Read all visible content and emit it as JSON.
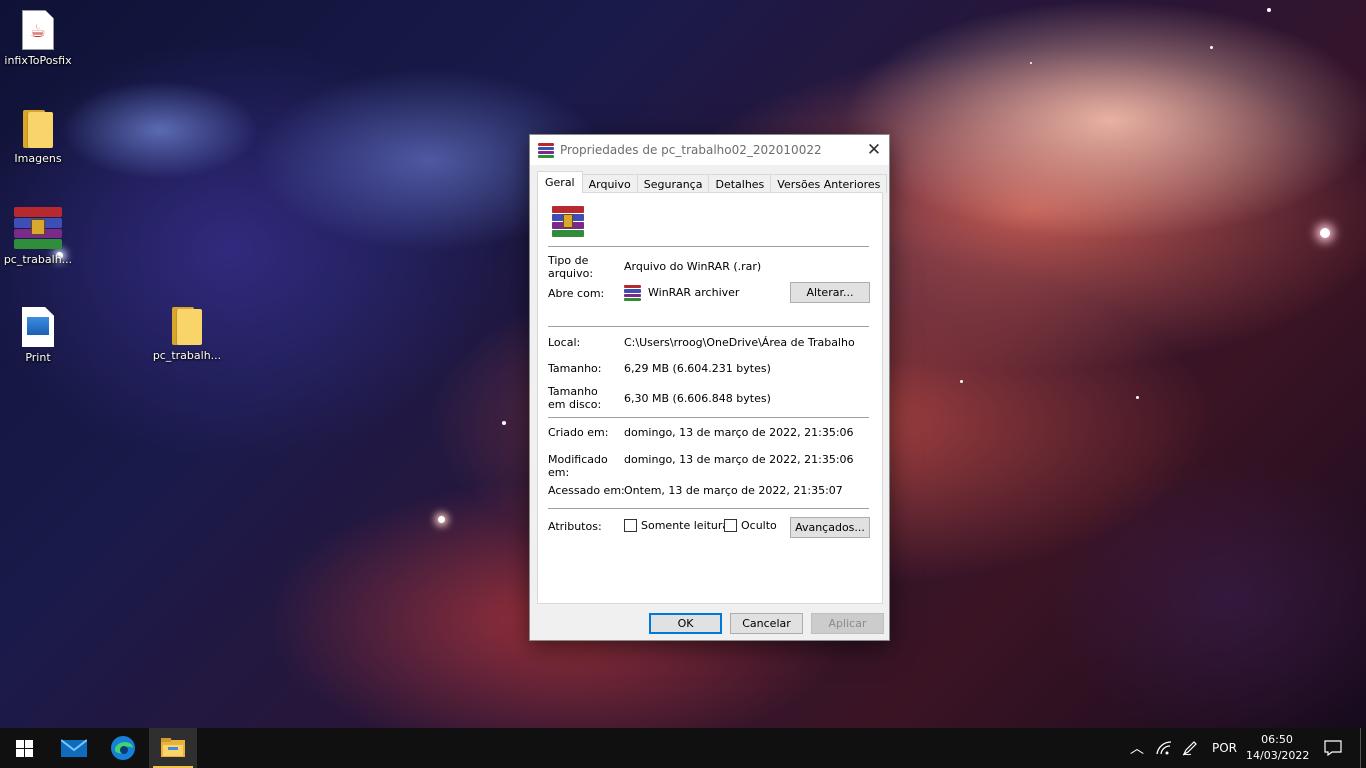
{
  "desktop": {
    "icons": [
      {
        "label": "infixToPosfix",
        "icon": "java-file-icon"
      },
      {
        "label": "Imagens",
        "icon": "folder-icon"
      },
      {
        "label": "pc_trabalh...",
        "icon": "winrar-archive-icon"
      },
      {
        "label": "Print",
        "icon": "image-file-icon"
      },
      {
        "label": "pc_trabalh...",
        "icon": "folder-icon"
      }
    ]
  },
  "dialog": {
    "title": "Propriedades de pc_trabalho02_202010022",
    "close_glyph": "✕",
    "tabs": [
      "Geral",
      "Arquivo",
      "Segurança",
      "Detalhes",
      "Versões Anteriores"
    ],
    "active_tab": "Geral",
    "file_type_label": "Tipo de arquivo:",
    "file_type_value": "Arquivo do WinRAR (.rar)",
    "opens_with_label": "Abre com:",
    "opens_with_value": "WinRAR archiver",
    "change_button": "Alterar...",
    "location_label": "Local:",
    "location_value": "C:\\Users\\rroog\\OneDrive\\Área de Trabalho",
    "size_label": "Tamanho:",
    "size_value": "6,29 MB (6.604.231 bytes)",
    "size_on_disk_label": "Tamanho em disco:",
    "size_on_disk_value": "6,30 MB (6.606.848 bytes)",
    "created_label": "Criado em:",
    "created_value": "domingo, 13 de março de 2022, 21:35:06",
    "modified_label": "Modificado em:",
    "modified_value": "domingo, 13 de março de 2022, 21:35:06",
    "accessed_label": "Acessado em:",
    "accessed_value": "Ontem, 13 de março de 2022, 21:35:07",
    "attributes_label": "Atributos:",
    "readonly_label": "Somente leitura",
    "readonly_checked": false,
    "hidden_label": "Oculto",
    "hidden_checked": false,
    "advanced_button": "Avançados...",
    "ok_button": "OK",
    "cancel_button": "Cancelar",
    "apply_button": "Aplicar"
  },
  "taskbar": {
    "pinned": [
      "windows-start-icon",
      "mail-icon",
      "edge-icon",
      "file-explorer-icon"
    ],
    "language": "POR",
    "time": "06:50",
    "date": "14/03/2022"
  },
  "colors": {
    "accent": "#0078d7",
    "taskbar": "#101010",
    "dialog_bg": "#f0f0f0"
  }
}
